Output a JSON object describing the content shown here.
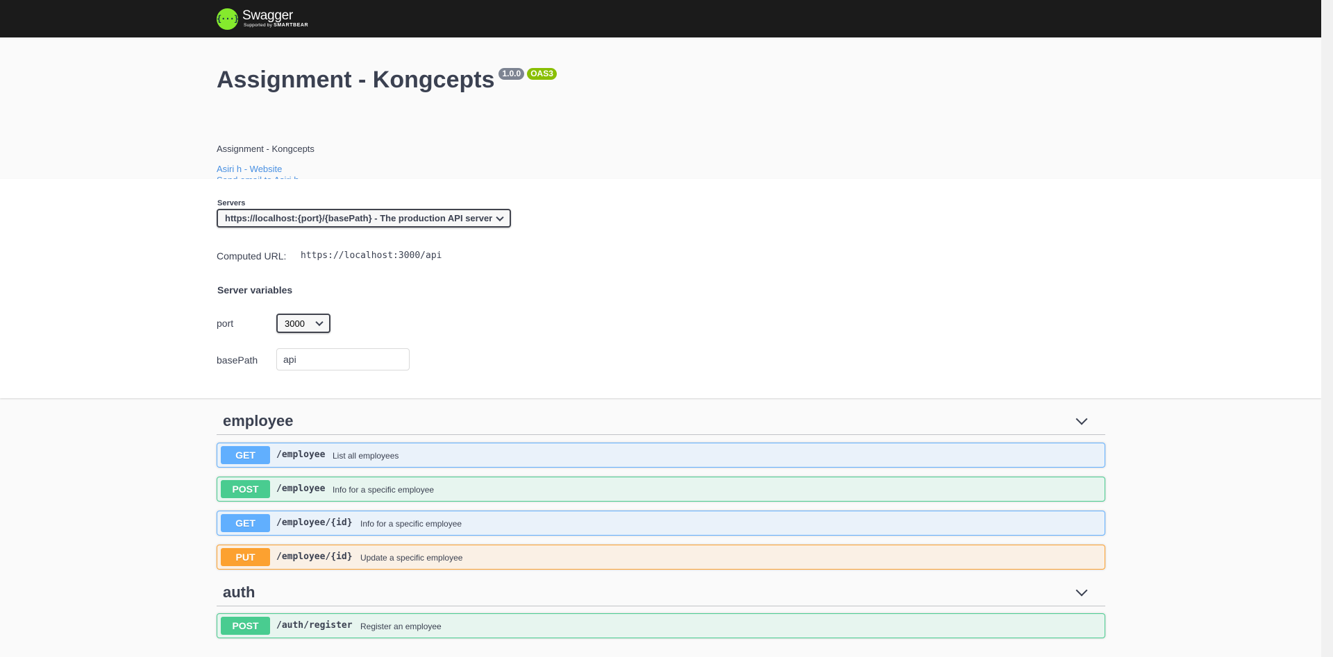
{
  "topbar": {
    "logo_glyph": "{···}",
    "logo_word": "Swagger",
    "logo_supported": "Supported by",
    "logo_brand": "SMARTBEAR"
  },
  "info": {
    "title": "Assignment - Kongcepts",
    "version_badge": "1.0.0",
    "oas_badge": "OAS3",
    "description": "Assignment - Kongcepts",
    "website_link": "Asiri h - Website",
    "email_link": "Send email to Asiri h"
  },
  "servers": {
    "label": "Servers",
    "selected": "https://localhost:{port}/{basePath} - The production API server",
    "computed_label": "Computed URL:",
    "computed_url": "https://localhost:3000/api",
    "variables_heading": "Server variables",
    "port_label": "port",
    "port_value": "3000",
    "basepath_label": "basePath",
    "basepath_value": "api"
  },
  "tags": [
    {
      "name": "employee",
      "operations": [
        {
          "method": "GET",
          "path": "/employee",
          "summary": "List all employees"
        },
        {
          "method": "POST",
          "path": "/employee",
          "summary": "Info for a specific employee"
        },
        {
          "method": "GET",
          "path": "/employee/{id}",
          "summary": "Info for a specific employee"
        },
        {
          "method": "PUT",
          "path": "/employee/{id}",
          "summary": "Update a specific employee"
        }
      ]
    },
    {
      "name": "auth",
      "operations": [
        {
          "method": "POST",
          "path": "/auth/register",
          "summary": "Register an employee"
        }
      ]
    }
  ],
  "colors": {
    "get": "#61affe",
    "post": "#49cc90",
    "put": "#fca130",
    "topbar": "#1b1b1b",
    "logo": "#85ea2d",
    "link": "#4990e2"
  }
}
